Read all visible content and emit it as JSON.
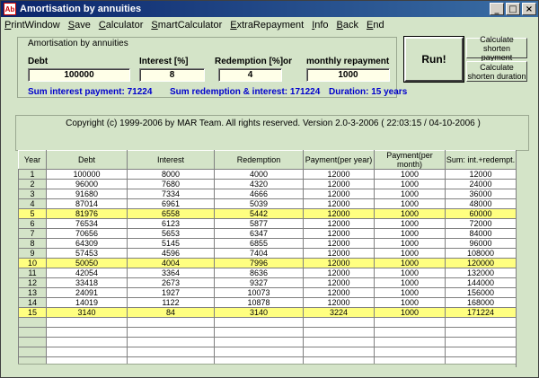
{
  "window": {
    "title": "Amortisation by annuities",
    "icon_label": "Ab"
  },
  "menu": [
    "PrintWindow",
    "Save",
    "Calculator",
    "SmartCalculator",
    "ExtraRepayment",
    "Info",
    "Back",
    "End"
  ],
  "group": {
    "title": "Amortisation by annuities",
    "debt_label": "Debt",
    "debt_value": "100000",
    "interest_label": "Interest [%]",
    "interest_value": "8",
    "redemption_label": "Redemption [%]",
    "or_label": "or",
    "redemption_value": "4",
    "monthly_label": "monthly repayment",
    "monthly_value": "1000"
  },
  "summary": {
    "interest": "Sum interest payment:  71224",
    "redemption": "Sum redemption & interest:  171224",
    "duration": "Duration:  15 years"
  },
  "buttons": {
    "run": "Run!",
    "shorten_payment": "Calculate shorten payment",
    "shorten_duration": "Calculate shorten duration"
  },
  "copyright": "Copyright (c) 1999-2006 by MAR Team. All rights reserved.  Version 2.0-3-2006  ( 22:03:15 / 04-10-2006 )",
  "table": {
    "headers": [
      "Year",
      "Debt",
      "Interest",
      "Redemption",
      "Payment(per year)",
      "Payment(per month)",
      "Sum: int.+redempt."
    ],
    "rows": [
      [
        "1",
        "100000",
        "8000",
        "4000",
        "12000",
        "1000",
        "12000"
      ],
      [
        "2",
        "96000",
        "7680",
        "4320",
        "12000",
        "1000",
        "24000"
      ],
      [
        "3",
        "91680",
        "7334",
        "4666",
        "12000",
        "1000",
        "36000"
      ],
      [
        "4",
        "87014",
        "6961",
        "5039",
        "12000",
        "1000",
        "48000"
      ],
      [
        "5",
        "81976",
        "6558",
        "5442",
        "12000",
        "1000",
        "60000"
      ],
      [
        "6",
        "76534",
        "6123",
        "5877",
        "12000",
        "1000",
        "72000"
      ],
      [
        "7",
        "70656",
        "5653",
        "6347",
        "12000",
        "1000",
        "84000"
      ],
      [
        "8",
        "64309",
        "5145",
        "6855",
        "12000",
        "1000",
        "96000"
      ],
      [
        "9",
        "57453",
        "4596",
        "7404",
        "12000",
        "1000",
        "108000"
      ],
      [
        "10",
        "50050",
        "4004",
        "7996",
        "12000",
        "1000",
        "120000"
      ],
      [
        "11",
        "42054",
        "3364",
        "8636",
        "12000",
        "1000",
        "132000"
      ],
      [
        "12",
        "33418",
        "2673",
        "9327",
        "12000",
        "1000",
        "144000"
      ],
      [
        "13",
        "24091",
        "1927",
        "10073",
        "12000",
        "1000",
        "156000"
      ],
      [
        "14",
        "14019",
        "1122",
        "10878",
        "12000",
        "1000",
        "168000"
      ],
      [
        "15",
        "3140",
        "84",
        "3140",
        "3224",
        "1000",
        "171224"
      ]
    ],
    "highlighted_years": [
      "5",
      "10",
      "15"
    ],
    "highlight_color": "#ffff80"
  }
}
